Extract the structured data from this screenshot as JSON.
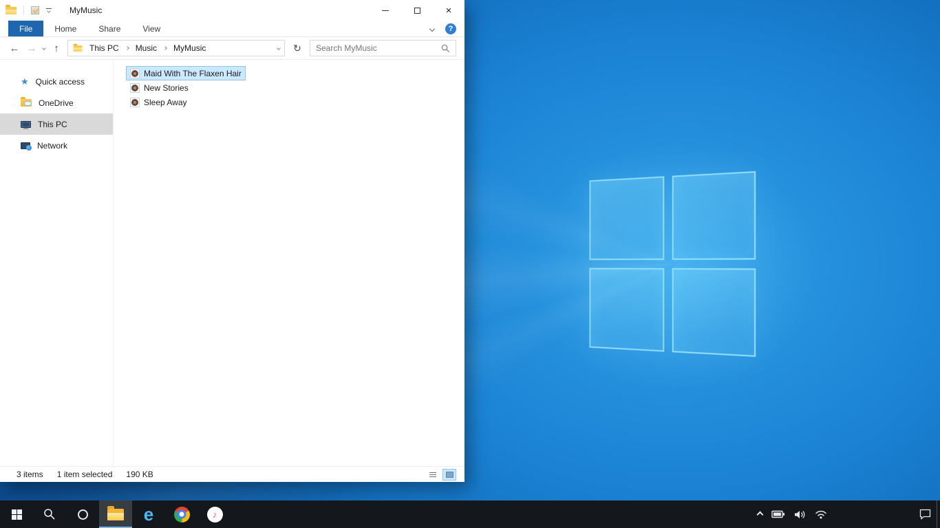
{
  "window": {
    "title": "MyMusic",
    "tabs": {
      "file": "File",
      "home": "Home",
      "share": "Share",
      "view": "View"
    },
    "breadcrumbs": [
      "This PC",
      "Music",
      "MyMusic"
    ],
    "search_placeholder": "Search MyMusic",
    "sidebar": [
      {
        "label": "Quick access"
      },
      {
        "label": "OneDrive"
      },
      {
        "label": "This PC",
        "selected": true
      },
      {
        "label": "Network"
      }
    ],
    "files": [
      {
        "name": "Maid With The Flaxen Hair",
        "selected": true
      },
      {
        "name": "New Stories"
      },
      {
        "name": "Sleep Away"
      }
    ],
    "status": {
      "count": "3 items",
      "selection": "1 item selected",
      "size": "190 KB"
    }
  },
  "glyphs": {
    "close": "×",
    "back": "←",
    "forward": "→",
    "up": "↑",
    "refresh": "↻",
    "help": "?",
    "star": "★",
    "note": "♪",
    "edge": "e"
  },
  "taskbar": {
    "icons": [
      "start",
      "search",
      "cortana",
      "file-explorer",
      "edge",
      "chrome",
      "itunes"
    ],
    "active_icon": "file-explorer",
    "tray": [
      "tray-expand",
      "battery",
      "volume",
      "network",
      "action-center"
    ]
  },
  "colors": {
    "accent": "#0078d7",
    "selection_bg": "#cce8ff",
    "selection_border": "#8fc6f0",
    "file_tab_bg": "#1e66ae",
    "desktop_blue": "#1b82d4",
    "taskbar_bg": "#14171c"
  }
}
